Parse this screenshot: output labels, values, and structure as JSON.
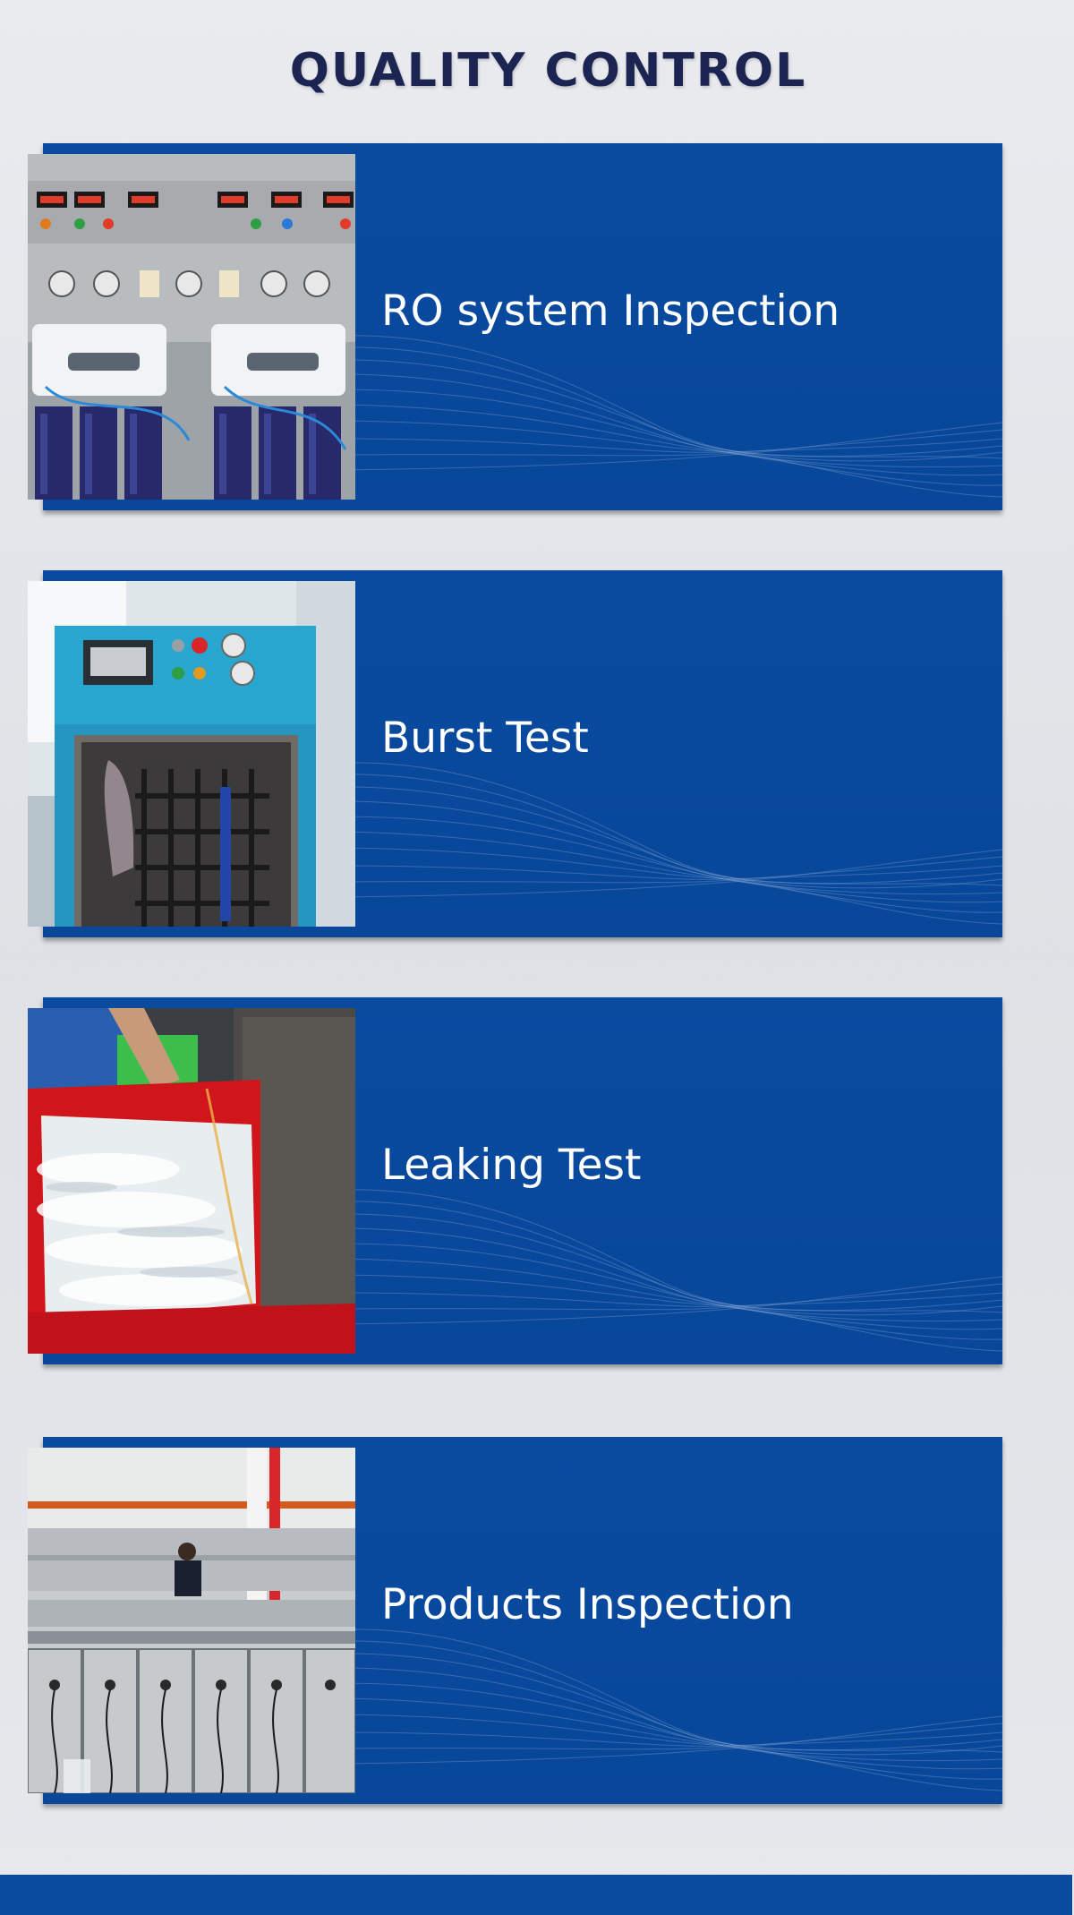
{
  "page": {
    "title": "QUALITY CONTROL"
  },
  "colors": {
    "background": "#e6e8ec",
    "title": "#1c2452",
    "card": "#0a4b9e",
    "card_text": "#ffffff",
    "footer": "#0a4b9e"
  },
  "cards": [
    {
      "label": "RO system Inspection",
      "photo": "ro-system-test-bench-photo"
    },
    {
      "label": "Burst Test",
      "photo": "burst-test-chamber-photo"
    },
    {
      "label": "Leaking Test",
      "photo": "leak-test-water-tank-photo"
    },
    {
      "label": "Products Inspection",
      "photo": "products-inspection-floor-photo"
    }
  ]
}
